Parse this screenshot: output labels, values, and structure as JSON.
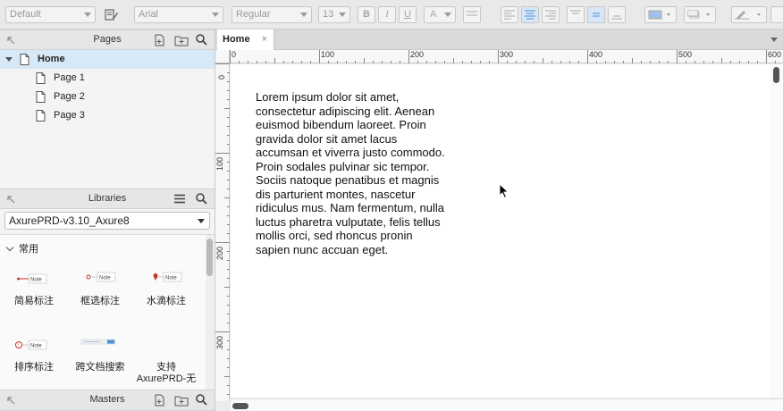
{
  "toolbar": {
    "style": "Default",
    "font": "Arial",
    "weight": "Regular",
    "size": "13",
    "bold": "B",
    "italic": "I",
    "underline": "U",
    "text_color": "A"
  },
  "pages_panel": {
    "title": "Pages",
    "root": "Home",
    "children": [
      "Page 1",
      "Page 2",
      "Page 3"
    ]
  },
  "libraries_panel": {
    "title": "Libraries",
    "selected_library": "AxurePRD-v3.10_Axure8",
    "group": "常用",
    "widgets": [
      {
        "label": "简易标注",
        "icon": "simple-note-icon"
      },
      {
        "label": "框选标注",
        "icon": "box-note-icon"
      },
      {
        "label": "水滴标注",
        "icon": "drop-note-icon"
      },
      {
        "label": "排序标注",
        "icon": "order-note-icon"
      },
      {
        "label": "跨文档搜索",
        "icon": "search-bar-icon"
      },
      {
        "label": "支持 AxurePRD-无",
        "icon": "support-icon"
      }
    ]
  },
  "masters_panel": {
    "title": "Masters"
  },
  "editor": {
    "tab": "Home",
    "tab_close": "×",
    "ruler_top": [
      "0",
      "100",
      "200",
      "300",
      "400",
      "500",
      "600"
    ],
    "ruler_left": [
      "0",
      "100",
      "200",
      "300"
    ],
    "lorem": "Lorem ipsum dolor sit amet, consectetur adipiscing elit. Aenean euismod bibendum laoreet. Proin gravida dolor sit amet lacus accumsan et viverra justo commodo. Proin sodales pulvinar sic tempor. Sociis natoque penatibus et magnis dis parturient montes, nascetur ridiculus mus. Nam fermentum, nulla luctus pharetra vulputate, felis tellus mollis orci, sed rhoncus pronin sapien nunc accuan eget."
  },
  "colors": {
    "selection": "#d7e8f6",
    "accent": "#4a90d9",
    "note_red": "#c0392b"
  }
}
